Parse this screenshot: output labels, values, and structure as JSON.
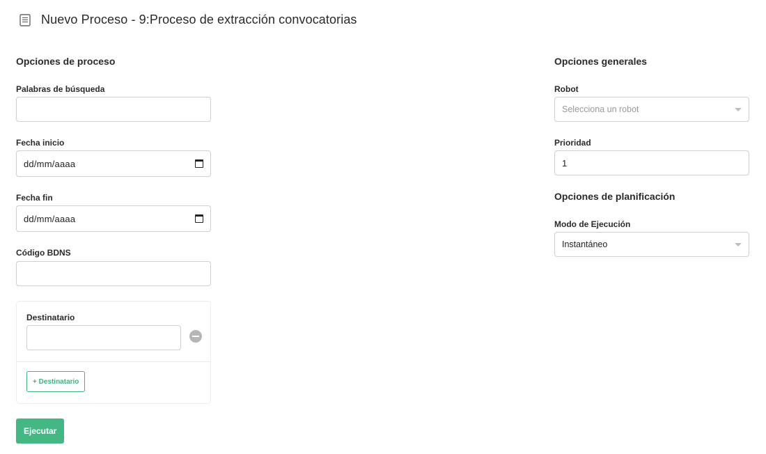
{
  "header": {
    "title": "Nuevo Proceso - 9:Proceso de extracción convocatorias",
    "icon": "document-icon"
  },
  "process_options": {
    "title": "Opciones de proceso",
    "search_words": {
      "label": "Palabras de búsqueda",
      "value": ""
    },
    "start_date": {
      "label": "Fecha inicio",
      "value": "dd/mm/aaaa",
      "icon": "calendar-icon"
    },
    "end_date": {
      "label": "Fecha fin",
      "value": "dd/mm/aaaa",
      "icon": "calendar-icon"
    },
    "bdns_code": {
      "label": "Código BDNS",
      "value": ""
    },
    "recipients": {
      "label": "Destinatario",
      "value": "",
      "remove_icon": "remove-circle-icon",
      "add_label": "+ Destinatario"
    },
    "execute_label": "Ejecutar"
  },
  "general_options": {
    "title": "Opciones generales",
    "robot": {
      "label": "Robot",
      "placeholder": "Selecciona un robot"
    },
    "priority": {
      "label": "Prioridad",
      "value": "1"
    }
  },
  "planning_options": {
    "title": "Opciones de planificación",
    "execution_mode": {
      "label": "Modo de Ejecución",
      "value": "Instantáneo"
    }
  },
  "colors": {
    "accent": "#44b884",
    "accent_outline": "#3fb27f",
    "border": "#cfcfcf",
    "placeholder": "#9a9a9a"
  }
}
